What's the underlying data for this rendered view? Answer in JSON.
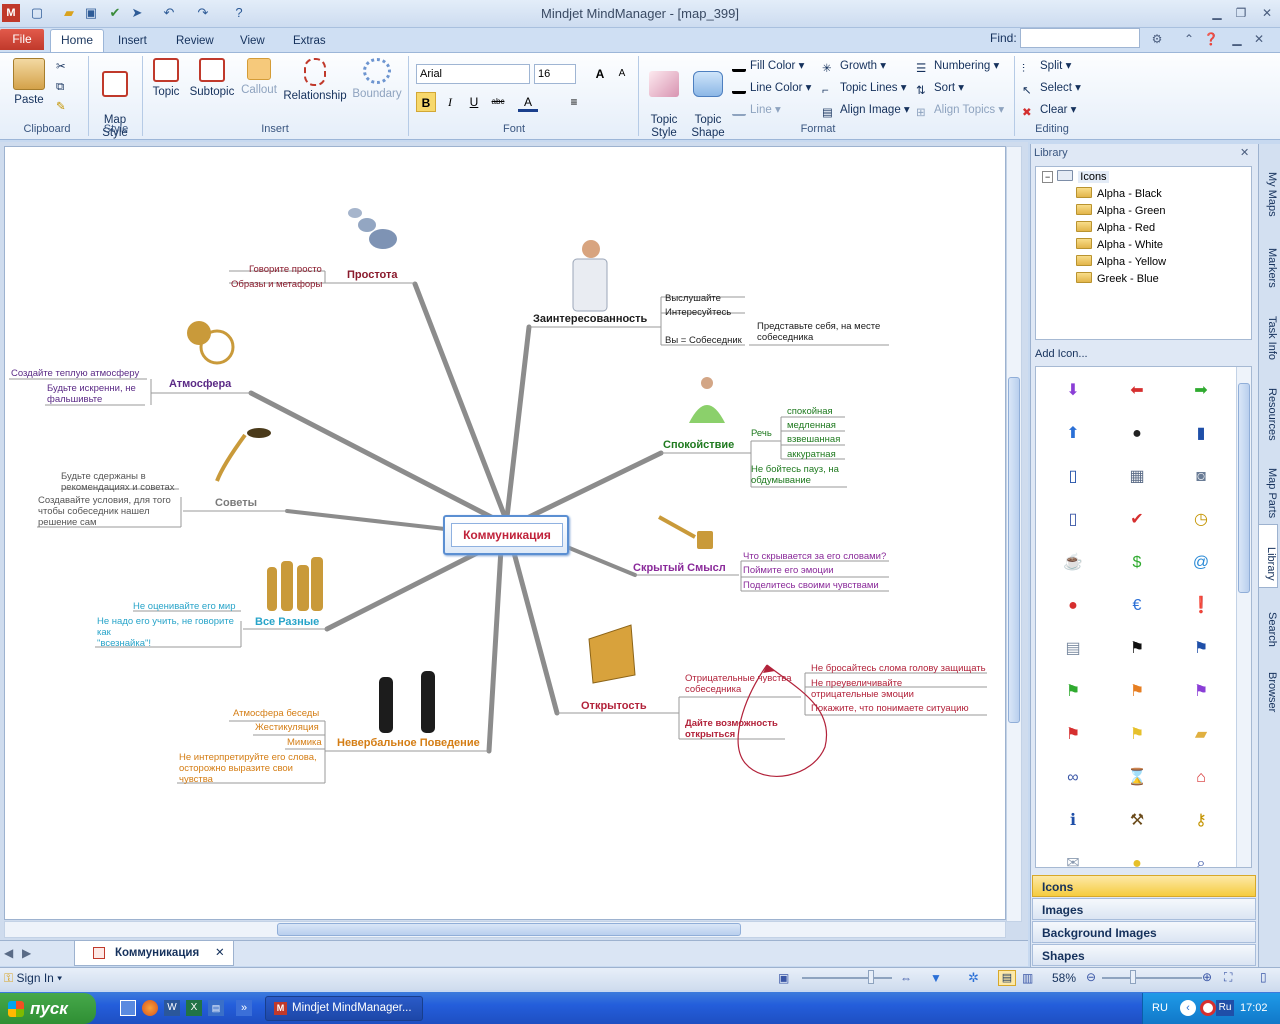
{
  "window": {
    "title": "Mindjet MindManager - [map_399]",
    "find_label": "Find:"
  },
  "tabs": {
    "file": "File",
    "home": "Home",
    "insert": "Insert",
    "review": "Review",
    "view": "View",
    "extras": "Extras"
  },
  "ribbon": {
    "clipboard": {
      "paste": "Paste",
      "group": "Clipboard"
    },
    "style": {
      "map_style": "Map\nStyle",
      "group": "Style"
    },
    "insert": {
      "topic": "Topic",
      "subtopic": "Subtopic",
      "callout": "Callout",
      "relationship": "Relationship",
      "boundary": "Boundary",
      "group": "Insert"
    },
    "font": {
      "name": "Arial",
      "size": "16",
      "group": "Font"
    },
    "format": {
      "topic_style": "Topic\nStyle",
      "topic_shape": "Topic\nShape",
      "fill_color": "Fill Color",
      "line_color": "Line Color",
      "line": "Line",
      "growth": "Growth",
      "topic_lines": "Topic Lines",
      "align_image": "Align Image",
      "numbering": "Numbering",
      "sort": "Sort",
      "align_topics": "Align Topics",
      "group": "Format"
    },
    "editing": {
      "split": "Split",
      "select": "Select",
      "clear": "Clear",
      "group": "Editing"
    }
  },
  "map": {
    "central": "Коммуникация",
    "prostota": {
      "title": "Простота",
      "items": [
        "Говорите просто",
        "Образы и метафоры"
      ]
    },
    "zainteres": {
      "title": "Заинтересованность",
      "items": [
        "Выслушайте",
        "Интересуйтесь",
        "Вы = Собеседник"
      ],
      "note": "Представьте себя, на месте\nсобеседника"
    },
    "atmosfera": {
      "title": "Атмосфера",
      "items": [
        "Создайте теплую атмосферу",
        "Будьте искренни, не\nфальшивьте"
      ]
    },
    "spokoistvie": {
      "title": "Спокойствие",
      "rech": "Речь",
      "rech_items": [
        "спокойная",
        "медленная",
        "взвешанная",
        "аккуратная"
      ],
      "pause": "Не бойтесь пауз, на\nобдумывание"
    },
    "sovety": {
      "title": "Советы",
      "items": [
        "Будьте сдержаны в\nрекомендациях и советах",
        "Создавайте условия, для того\nчтобы собеседник нашел\nрешение сам"
      ]
    },
    "skryty": {
      "title": "Скрытый Смысл",
      "items": [
        "Что скрывается за его словами?",
        "Поймите его эмоции",
        "Поделитесь своими чувствами"
      ]
    },
    "vse": {
      "title": "Все Разные",
      "items": [
        "Не оценивайте его мир",
        "Не надо его учить, не говорите\nкак\n\"всезнайка\"!"
      ]
    },
    "otkryt": {
      "title": "Открытость",
      "feel": "Отрицательные чувства\nсобеседника",
      "feel_items": [
        "Не бросайтесь слома голову защищать",
        "Не преувеличивайте\nотрицательные эмоции",
        "Покажите, что понимаете ситуацию"
      ],
      "give": "Дайте возможность\nоткрыться"
    },
    "neverb": {
      "title": "Невербальное Поведение",
      "items": [
        "Атмосфера беседы",
        "Жестикуляция",
        "Мимика",
        "Не интерпретируйте его слова,\nосторожно выразите свои\nчувства"
      ]
    }
  },
  "library": {
    "title": "Library",
    "root": "Icons",
    "folders": [
      "Alpha - Black",
      "Alpha - Green",
      "Alpha - Red",
      "Alpha - White",
      "Alpha - Yellow",
      "Greek -  Blue"
    ],
    "add_icon": "Add Icon...",
    "sections": [
      "Icons",
      "Images",
      "Background Images",
      "Shapes"
    ]
  },
  "side_tabs": [
    "My Maps",
    "Markers",
    "Task Info",
    "Resources",
    "Map Parts",
    "Library",
    "Search",
    "Browser"
  ],
  "doc_tab": "Коммуникация",
  "status": {
    "sign_in": "Sign In",
    "zoom": "58%"
  },
  "taskbar": {
    "start": "пуск",
    "app": "Mindjet MindManager...",
    "lang": "RU",
    "time": "17:02",
    "ru": "Ru"
  },
  "colors": {
    "accent": "#f5cc3f",
    "file_tab": "#c0392b",
    "central_border": "#5b8fd2",
    "taskbar": "#245edb"
  }
}
